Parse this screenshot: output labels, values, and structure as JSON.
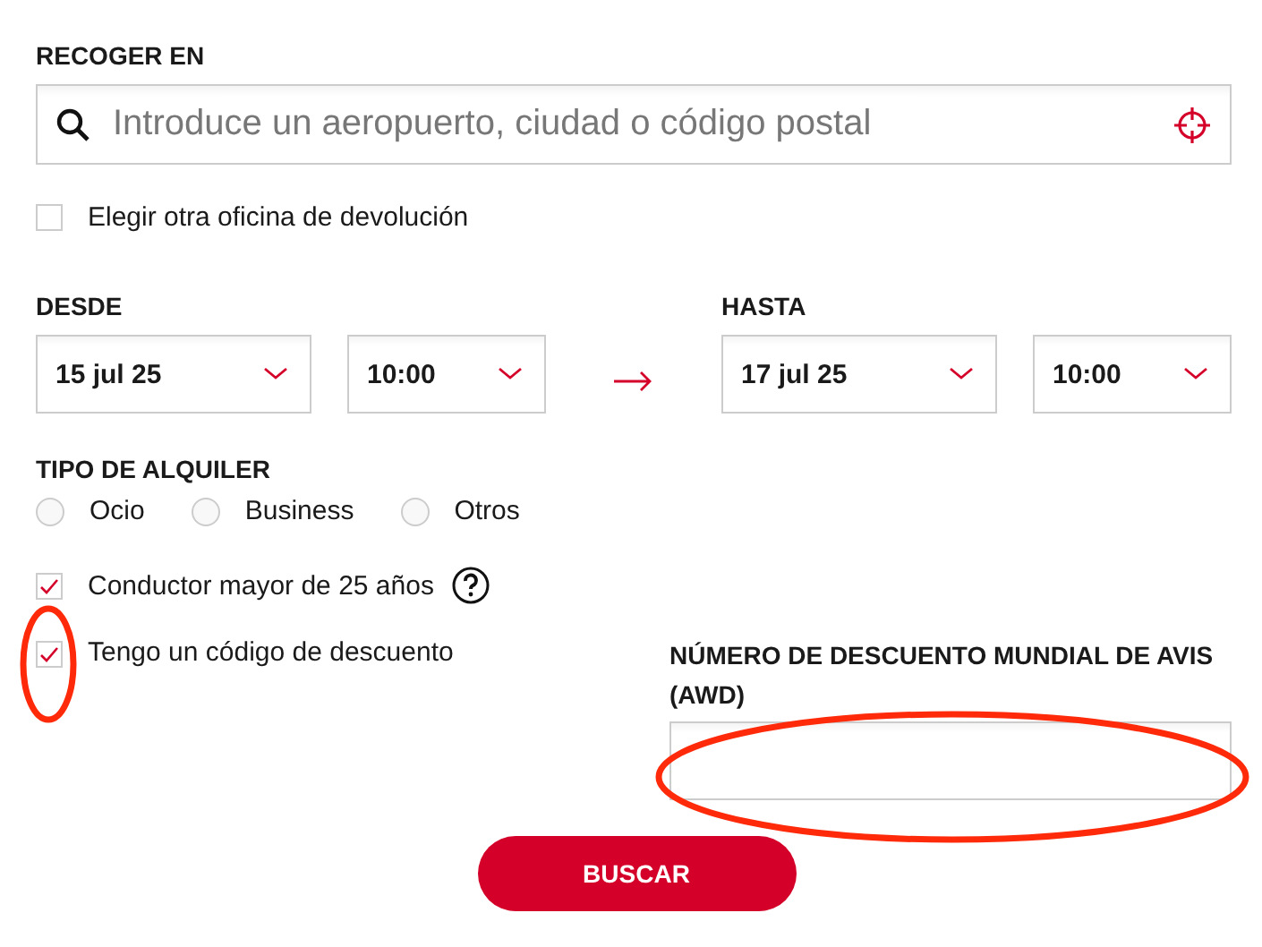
{
  "pickup": {
    "label": "RECOGER EN",
    "placeholder": "Introduce un aeropuerto, ciudad o código postal"
  },
  "return_office": {
    "label": "Elegir otra oficina de devolución",
    "checked": false
  },
  "from": {
    "label": "DESDE",
    "date": "15 jul 25",
    "time": "10:00"
  },
  "to": {
    "label": "HASTA",
    "date": "17 jul 25",
    "time": "10:00"
  },
  "rental_type": {
    "label": "TIPO DE ALQUILER",
    "options": [
      {
        "label": "Ocio",
        "selected": false
      },
      {
        "label": "Business",
        "selected": false
      },
      {
        "label": "Otros",
        "selected": false
      }
    ]
  },
  "driver_age": {
    "label": "Conductor mayor de 25 años",
    "checked": true
  },
  "discount": {
    "label": "Tengo un código de descuento",
    "checked": true,
    "highlighted": true
  },
  "awd": {
    "label": "NÚMERO DE DESCUENTO MUNDIAL DE AVIS (AWD)",
    "highlighted": true
  },
  "search_button": {
    "label": "BUSCAR"
  }
}
